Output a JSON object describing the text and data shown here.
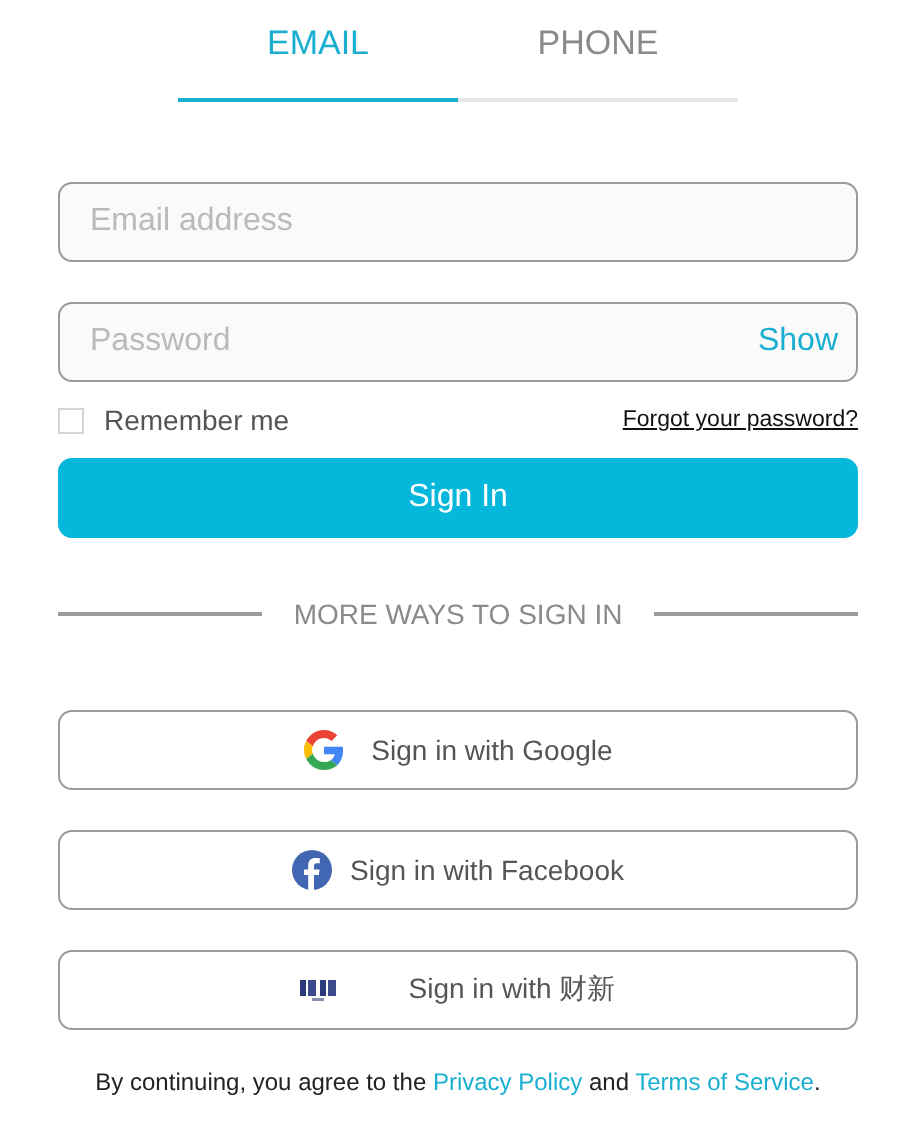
{
  "tabs": [
    {
      "label": "EMAIL",
      "selected": true
    },
    {
      "label": "PHONE",
      "selected": false
    }
  ],
  "fields": [
    {
      "placeholder": "Email address"
    },
    {
      "placeholder": "Password",
      "toggle": "Show"
    }
  ],
  "remember": {
    "label": "Remember me",
    "checked": false
  },
  "forgot_link": "Forgot your password?",
  "sign_in_button": "Sign In",
  "divider_label": "MORE WAYS TO SIGN IN",
  "social_buttons": [
    {
      "kind": "google",
      "label": "Sign in with Google"
    },
    {
      "kind": "facebook",
      "label": "Sign in with Facebook"
    },
    {
      "kind": "caixin",
      "label": "Sign in with 财新"
    }
  ],
  "footer": [
    {
      "kind": "text",
      "text": "By continuing, you agree to the "
    },
    {
      "kind": "link",
      "text": "Privacy Policy"
    },
    {
      "kind": "text",
      "text": " and "
    },
    {
      "kind": "link",
      "text": "Terms of Service"
    },
    {
      "kind": "text",
      "text": "."
    }
  ]
}
